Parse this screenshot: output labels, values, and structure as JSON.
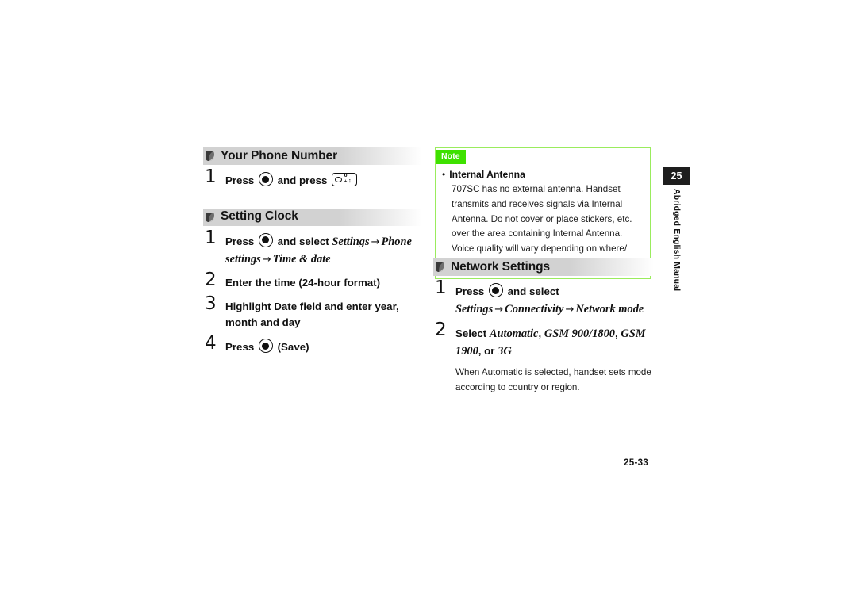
{
  "page": {
    "folio": "25-33",
    "side_tab_number": "25",
    "side_tab_label": "Abridged English Manual",
    "accent_green": "#3ee100",
    "note_border_green": "#9aec5d",
    "header_gray": "#d2d2d2"
  },
  "icons": {
    "section_marker": "section-marker-icon",
    "center_key": "center-select-key-icon",
    "zero_key": "zero-plus-key-icon"
  },
  "left_column": {
    "sections": [
      {
        "title": "Your Phone Number",
        "steps": [
          {
            "number": "1",
            "parts": [
              {
                "type": "text",
                "value": "Press "
              },
              {
                "type": "key",
                "value": "center-select-key-icon"
              },
              {
                "type": "text",
                "value": " and press "
              },
              {
                "type": "key",
                "value": "zero-plus-key-icon"
              }
            ]
          }
        ]
      },
      {
        "title": "Setting Clock",
        "steps": [
          {
            "number": "1",
            "parts": [
              {
                "type": "text",
                "value": "Press "
              },
              {
                "type": "key",
                "value": "center-select-key-icon"
              },
              {
                "type": "text",
                "value": " and select "
              },
              {
                "type": "italic",
                "value": "Settings"
              },
              {
                "type": "arrow",
                "value": "→"
              },
              {
                "type": "italic",
                "value": "Phone settings"
              },
              {
                "type": "arrow",
                "value": "→"
              },
              {
                "type": "italic",
                "value": "Time & date"
              }
            ]
          },
          {
            "number": "2",
            "parts": [
              {
                "type": "text",
                "value": "Enter the time (24-hour format)"
              }
            ]
          },
          {
            "number": "3",
            "parts": [
              {
                "type": "text",
                "value": "Highlight Date field and enter year, month and day"
              }
            ]
          },
          {
            "number": "4",
            "parts": [
              {
                "type": "text",
                "value": "Press "
              },
              {
                "type": "key",
                "value": "center-select-key-icon"
              },
              {
                "type": "text",
                "value": " (Save)"
              }
            ]
          }
        ]
      }
    ]
  },
  "note_box": {
    "tab_label": "Note",
    "heading": "Internal Antenna",
    "body": "707SC has no external antenna. Handset transmits and receives signals via Internal Antenna. Do not cover or place stickers, etc. over the area containing Internal Antenna. Voice quality will vary depending on where/ how handset is used."
  },
  "right_column": {
    "sections": [
      {
        "title": "Network Settings",
        "steps": [
          {
            "number": "1",
            "parts": [
              {
                "type": "text",
                "value": "Press "
              },
              {
                "type": "key",
                "value": "center-select-key-icon"
              },
              {
                "type": "text",
                "value": " and select "
              },
              {
                "type": "italic",
                "value": "Settings"
              },
              {
                "type": "arrow",
                "value": "→"
              },
              {
                "type": "italic",
                "value": "Connectivity"
              },
              {
                "type": "arrow",
                "value": "→"
              },
              {
                "type": "italic",
                "value": "Network mode"
              }
            ]
          },
          {
            "number": "2",
            "parts": [
              {
                "type": "text",
                "value": "Select "
              },
              {
                "type": "italic",
                "value": "Automatic"
              },
              {
                "type": "text",
                "value": ", "
              },
              {
                "type": "italic",
                "value": "GSM 900/1800"
              },
              {
                "type": "text",
                "value": ", "
              },
              {
                "type": "italic",
                "value": "GSM 1900"
              },
              {
                "type": "text",
                "value": ", or "
              },
              {
                "type": "italic",
                "value": "3G"
              }
            ],
            "sub": "When Automatic is selected, handset sets mode according to country or region."
          }
        ]
      }
    ]
  }
}
